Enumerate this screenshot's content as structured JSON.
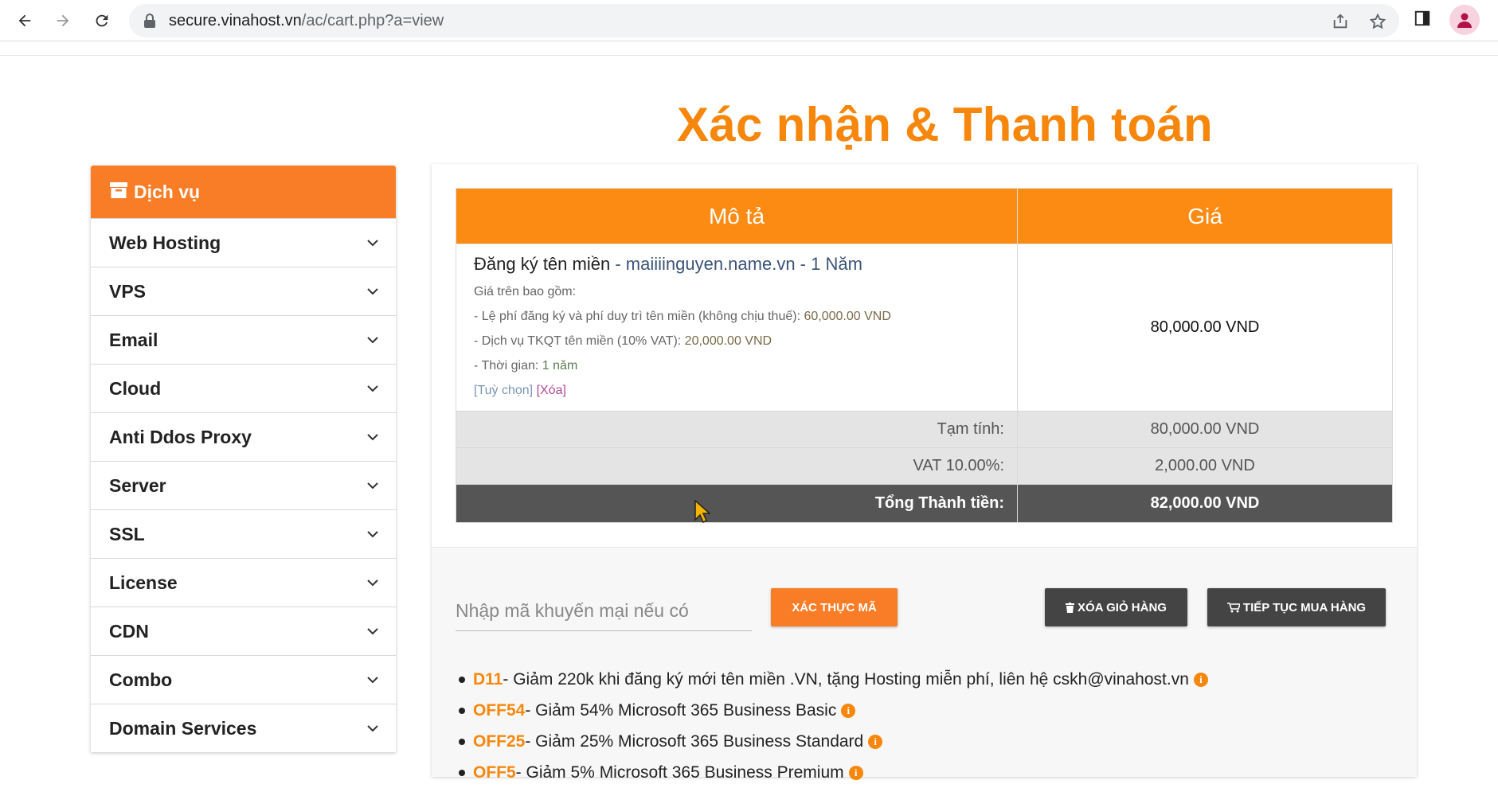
{
  "browser": {
    "url_host": "secure.vinahost.vn",
    "url_path": "/ac/cart.php?a=view"
  },
  "page": {
    "title": "Xác nhận & Thanh toán"
  },
  "sidebar": {
    "header": "Dịch vụ",
    "items": [
      {
        "label": "Web Hosting"
      },
      {
        "label": "VPS"
      },
      {
        "label": "Email"
      },
      {
        "label": "Cloud"
      },
      {
        "label": "Anti Ddos Proxy"
      },
      {
        "label": "Server"
      },
      {
        "label": "SSL"
      },
      {
        "label": "License"
      },
      {
        "label": "CDN"
      },
      {
        "label": "Combo"
      },
      {
        "label": "Domain Services"
      }
    ]
  },
  "cart": {
    "col_desc": "Mô tả",
    "col_price": "Giá",
    "item": {
      "name": "Đăng ký tên miền",
      "domain": "- maiiiinguyen.name.vn - 1 Năm",
      "includes_label": "Giá trên bao gồm:",
      "line1_label": "- Lệ phí đăng ký và phí duy trì tên miền (không chịu thuế): ",
      "line1_value": "60,000.00 VND",
      "line2_label": "- Dịch vụ TKQT tên miền (10% VAT): ",
      "line2_value": "20,000.00 VND",
      "line3_label": "- Thời gian: ",
      "line3_value": "1 năm",
      "option_link": "[Tuỳ chọn]",
      "remove_link": "[Xóa]",
      "price": "80,000.00 VND"
    },
    "subtotal_label": "Tạm tính:",
    "subtotal_value": "80,000.00 VND",
    "vat_label": "VAT 10.00%:",
    "vat_value": "2,000.00 VND",
    "total_label": "Tổng Thành tiền:",
    "total_value": "82,000.00 VND"
  },
  "promo": {
    "placeholder": "Nhập mã khuyến mại nếu có",
    "validate_button": "XÁC THỰC MÃ",
    "clear_cart_button": "XÓA GIỎ HÀNG",
    "continue_button": "TIẾP TỤC MUA HÀNG",
    "codes": [
      {
        "code": "D11",
        "text": " - Giảm 220k khi đăng ký mới tên miền .VN, tặng Hosting miễn phí, liên hệ cskh@vinahost.vn"
      },
      {
        "code": "OFF54",
        "text": " - Giảm 54% Microsoft 365 Business Basic"
      },
      {
        "code": "OFF25",
        "text": " - Giảm 25% Microsoft 365 Business Standard"
      },
      {
        "code": "OFF5",
        "text": " - Giảm 5% Microsoft 365 Business Premium"
      }
    ]
  },
  "colors": {
    "brand_orange": "#f7870c",
    "sidebar_header": "#f97c26",
    "dark_button": "#444444"
  }
}
